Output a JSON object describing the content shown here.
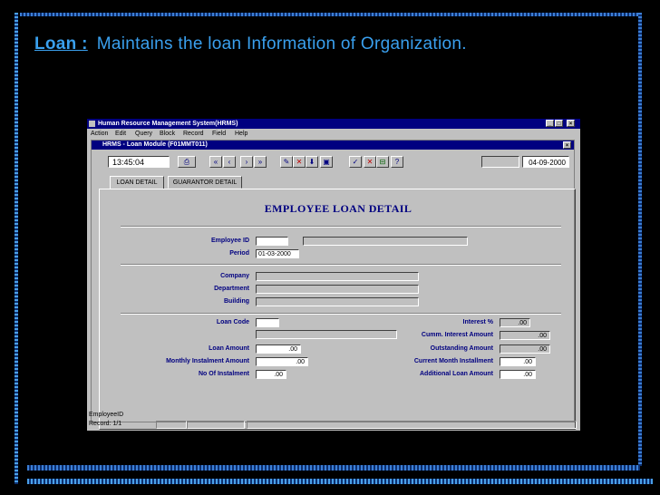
{
  "slide": {
    "keyword": "Loan :",
    "subtitle": "Maintains the  loan  Information of Organization."
  },
  "app": {
    "title": "Human Resource Management System(HRMS)",
    "menu": [
      "Action",
      "Edit",
      "Query",
      "Block",
      "Record",
      "Field",
      "Help"
    ],
    "window_controls": {
      "minimize": "_",
      "maximize": "□",
      "close": "×"
    },
    "form_title": "HRMS - Loan Module  (F01MMT011)",
    "time": "13:45:04",
    "date": "04-09-2000",
    "tabs": [
      "LOAN DETAIL",
      "GUARANTOR DETAIL"
    ],
    "heading": "EMPLOYEE LOAN DETAIL",
    "fields": {
      "employee_id": "Employee ID",
      "period": "Period",
      "period_value": "01-03-2000",
      "company": "Company",
      "department": "Department",
      "building": "Building",
      "loan_code": "Loan Code",
      "interest": "Interest %",
      "interest_value": ".00",
      "cumm_interest": "Cumm. Interest Amount",
      "cumm_interest_value": ".00",
      "loan_amount": "Loan Amount",
      "loan_amount_value": ".00",
      "outstanding": "Outstanding Amount",
      "outstanding_value": ".00",
      "monthly_inst": "Monthly Instalment Amount",
      "monthly_inst_value": ".00",
      "current_month": "Current Month Installment",
      "current_month_value": ".00",
      "no_of_inst": "No Of Instalment",
      "no_of_inst_value": ".00",
      "additional": "Additional Loan Amount",
      "additional_value": ".00"
    },
    "status": {
      "field": "EmployeeID",
      "record": "Record: 1/1"
    }
  }
}
